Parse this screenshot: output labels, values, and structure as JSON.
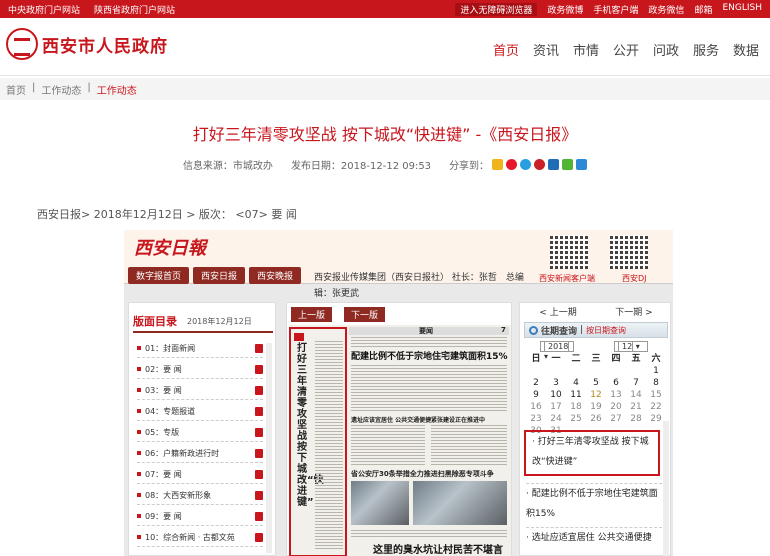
{
  "topbar": {
    "left": [
      "中央政府门户网站",
      "陕西省政府门户网站"
    ],
    "highlight": "进入无障碍浏览器",
    "right": [
      "政务微博",
      "手机客户端",
      "政务微信",
      "邮箱",
      "ENGLISH"
    ],
    "bg_color": "#c8161d"
  },
  "header": {
    "logo_text": "西安市人民政府",
    "nav": [
      "首页",
      "资讯",
      "市情",
      "公开",
      "问政",
      "服务",
      "数据"
    ],
    "active_nav": "首页"
  },
  "breadcrumb": [
    "首页",
    "工作动态",
    "工作动态"
  ],
  "article": {
    "title": "打好三年清零攻坚战 按下城改“快进键” -《西安日报》",
    "source": "信息来源：市城改办",
    "date": "发布日期：2018-12-12 09:53",
    "share_label": "分享到：",
    "share_icons": [
      "star-icon",
      "weibo-icon",
      "qq-icon",
      "pinterest-icon",
      "renren-icon",
      "weixin-icon",
      "plus-icon"
    ],
    "issue_line": "西安日报> 2018年12月12日 > 版次： <07> 要 闻"
  },
  "paper": {
    "masthead_logo": "西安日報",
    "tabs": [
      "数字报首页",
      "西安日报",
      "西安晚报"
    ],
    "info": "西安报业传媒集团（西安日报社） 社长：张哲　总编辑：张更武",
    "qr_captions": [
      "西安新闻客户端",
      "西安DJ"
    ],
    "left_panel": {
      "heading": "版面目录",
      "date": "2018年12月12日",
      "items": [
        "01：封面新闻",
        "02：要 闻",
        "03：要 闻",
        "04：专题报道",
        "05：专版",
        "06：户籍新政进行时",
        "07：要 闻",
        "08：大西安新形象",
        "09：要 闻",
        "10：综合新闻 · 古都文苑"
      ]
    },
    "center_panel": {
      "prev": "上一版",
      "next": "下一版",
      "page_label": "要闻",
      "page_no": "7",
      "vertical_headline": "打好三年清零攻坚战 按下城改“快进键”",
      "headline_top": "配建比例不低于宗地住宅建筑面积15%",
      "head_mid1": "遗址应该宜居住 公共交通便捷",
      "head_mid2": "紧张建设正在推进中",
      "head_mid3": "省公安厅30条举措全力推进扫黑除恶专项斗争",
      "headline_bottom": "这里的臭水坑让村民苦不堪言"
    },
    "right_panel": {
      "prev": "上一期",
      "next": "下一期",
      "query": "往期查询",
      "query_sub": "按日期查询",
      "year": "2018",
      "month": "12",
      "weekdays": [
        "日",
        "一",
        "二",
        "三",
        "四",
        "五",
        "六"
      ],
      "calendar": [
        [
          "",
          "",
          "",
          "",
          "",
          "",
          "1"
        ],
        [
          "2",
          "3",
          "4",
          "5",
          "6",
          "7",
          "8"
        ],
        [
          "9",
          "10",
          "11",
          "12",
          "13",
          "14",
          "15"
        ],
        [
          "16",
          "17",
          "18",
          "19",
          "20",
          "21",
          "22"
        ],
        [
          "23",
          "24",
          "25",
          "26",
          "27",
          "28",
          "29"
        ],
        [
          "30",
          "31",
          "",
          "",
          "",
          "",
          ""
        ]
      ],
      "current_day": "12",
      "news": [
        "· 打好三年清零攻坚战 按下城改“快进键”",
        "· 配建比例不低于宗地住宅建筑面积15%",
        "· 选址应适宜居住 公共交通便捷"
      ]
    }
  }
}
